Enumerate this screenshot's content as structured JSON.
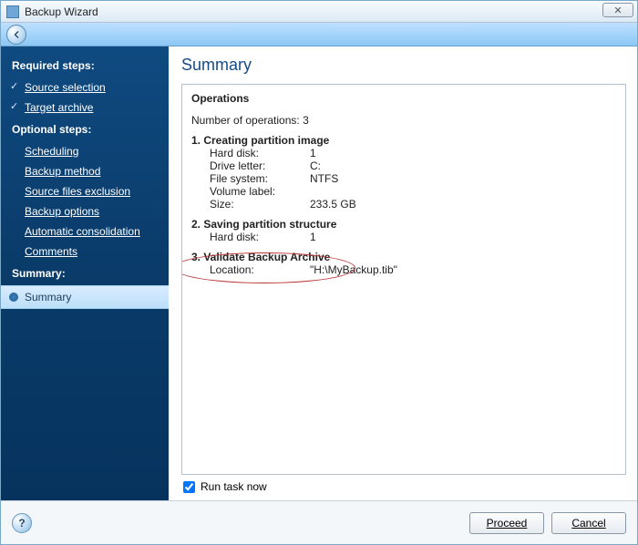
{
  "window": {
    "title": "Backup Wizard"
  },
  "sidebar": {
    "required_heading": "Required steps:",
    "required_items": [
      {
        "label": "Source selection"
      },
      {
        "label": "Target archive"
      }
    ],
    "optional_heading": "Optional steps:",
    "optional_items": [
      {
        "label": "Scheduling"
      },
      {
        "label": "Backup method"
      },
      {
        "label": "Source files exclusion"
      },
      {
        "label": "Backup options"
      },
      {
        "label": "Automatic consolidation"
      },
      {
        "label": "Comments"
      }
    ],
    "summary_heading": "Summary:",
    "summary_item": "Summary"
  },
  "main": {
    "title": "Summary",
    "operations_heading": "Operations",
    "num_ops_label": "Number of operations:",
    "num_ops_value": "3",
    "step1": {
      "title": "1. Creating partition image",
      "hard_disk_label": "Hard disk:",
      "hard_disk_value": "1",
      "drive_letter_label": "Drive letter:",
      "drive_letter_value": "C:",
      "file_system_label": "File system:",
      "file_system_value": "NTFS",
      "volume_label_label": "Volume label:",
      "volume_label_value": "",
      "size_label": "Size:",
      "size_value": "233.5 GB"
    },
    "step2": {
      "title": "2. Saving partition structure",
      "hard_disk_label": "Hard disk:",
      "hard_disk_value": "1"
    },
    "step3": {
      "title": "3. Validate Backup Archive",
      "location_label": "Location:",
      "location_value": "\"H:\\MyBackup.tib\""
    },
    "run_task_label": "Run task now"
  },
  "footer": {
    "proceed_label": "Proceed",
    "cancel_label": "Cancel"
  }
}
